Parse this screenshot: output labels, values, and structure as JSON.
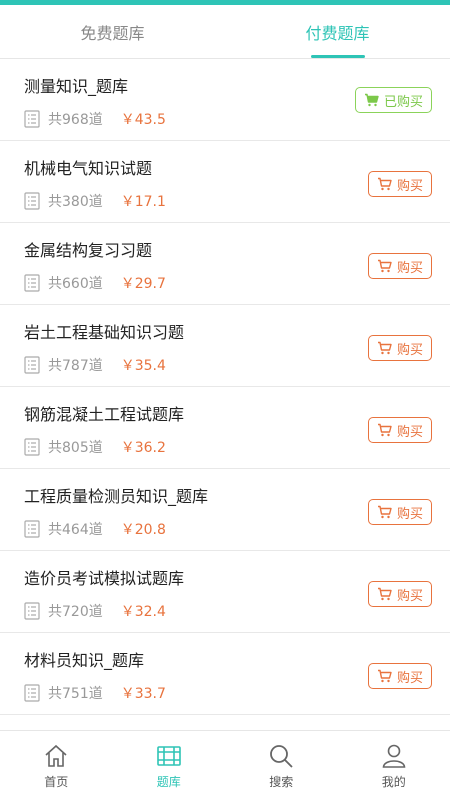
{
  "tabs": [
    {
      "label": "免费题库",
      "active": false
    },
    {
      "label": "付费题库",
      "active": true
    }
  ],
  "items": [
    {
      "title": "测量知识_题库",
      "count": "共968道",
      "price": "￥43.5",
      "button": "已购买",
      "bought": true
    },
    {
      "title": "机械电气知识试题",
      "count": "共380道",
      "price": "￥17.1",
      "button": "购买",
      "bought": false
    },
    {
      "title": "金属结构复习习题",
      "count": "共660道",
      "price": "￥29.7",
      "button": "购买",
      "bought": false
    },
    {
      "title": "岩土工程基础知识习题",
      "count": "共787道",
      "price": "￥35.4",
      "button": "购买",
      "bought": false
    },
    {
      "title": "钢筋混凝土工程试题库",
      "count": "共805道",
      "price": "￥36.2",
      "button": "购买",
      "bought": false
    },
    {
      "title": "工程质量检测员知识_题库",
      "count": "共464道",
      "price": "￥20.8",
      "button": "购买",
      "bought": false
    },
    {
      "title": "造价员考试模拟试题库",
      "count": "共720道",
      "price": "￥32.4",
      "button": "购买",
      "bought": false
    },
    {
      "title": "材料员知识_题库",
      "count": "共751道",
      "price": "￥33.7",
      "button": "购买",
      "bought": false
    }
  ],
  "bottom_nav": [
    {
      "label": "首页",
      "icon": "home-icon",
      "active": false
    },
    {
      "label": "题库",
      "icon": "question-bank-icon",
      "active": true
    },
    {
      "label": "搜索",
      "icon": "search-icon",
      "active": false
    },
    {
      "label": "我的",
      "icon": "user-icon",
      "active": false
    }
  ],
  "colors": {
    "accent": "#2ec4b6",
    "price": "#e8733e",
    "bought": "#7cc84a"
  }
}
